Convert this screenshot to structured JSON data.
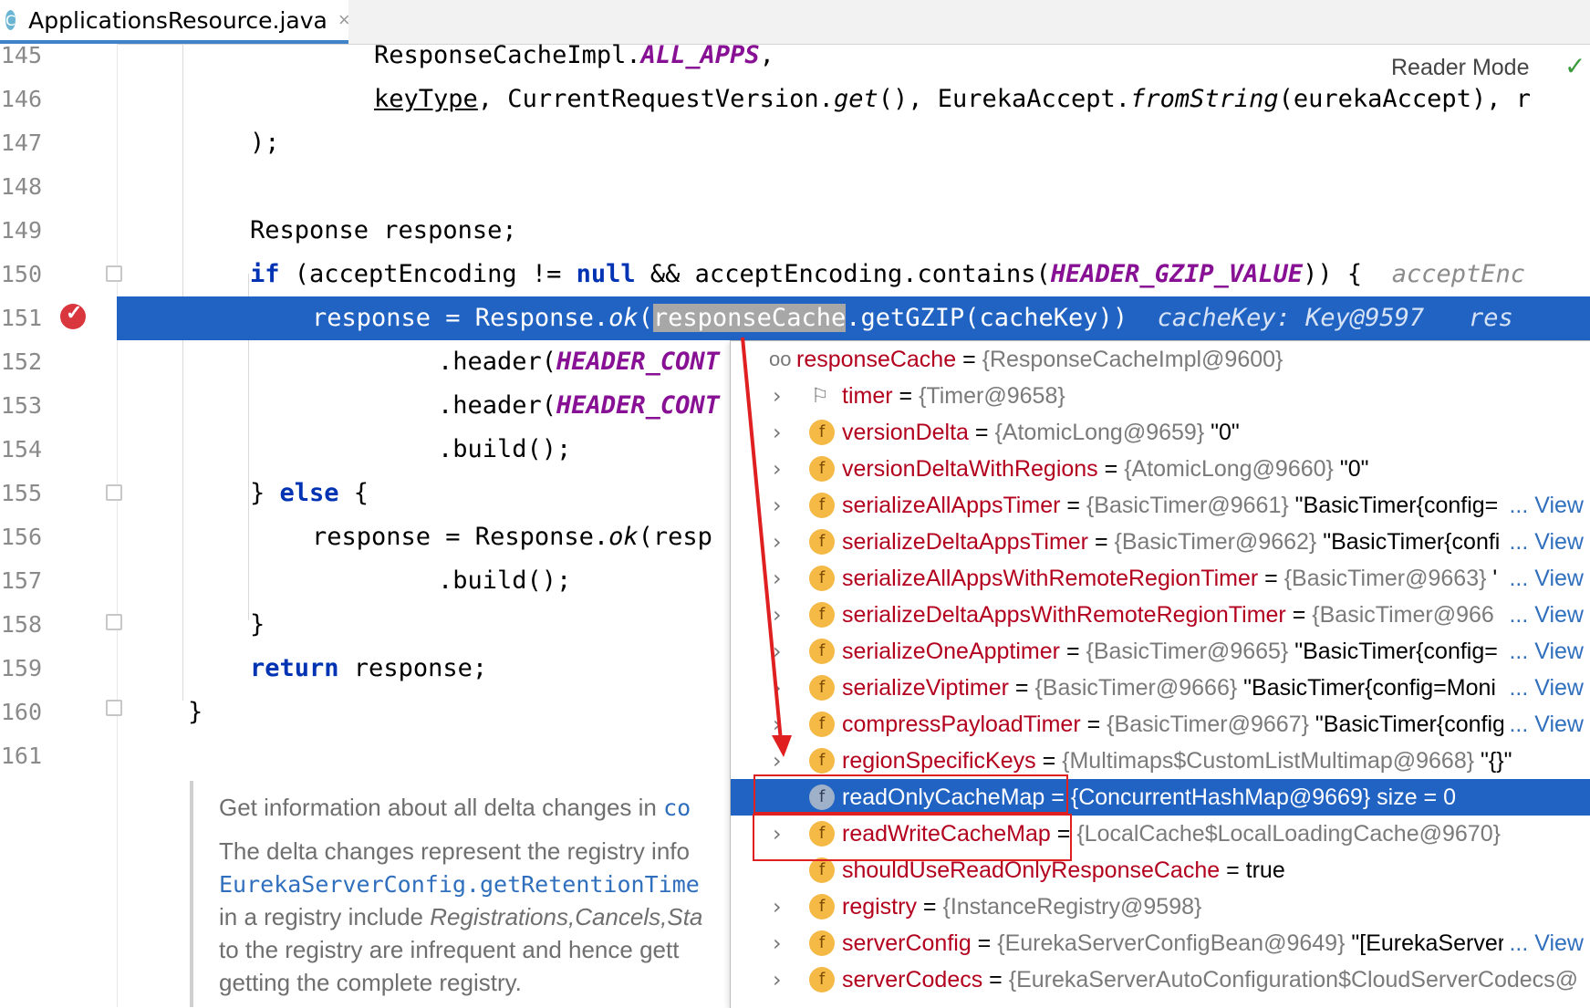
{
  "tab": {
    "icon_letter": "C",
    "filename": "ApplicationsResource.java",
    "close": "×"
  },
  "reader_mode": "Reader Mode",
  "code_lines": [
    {
      "num": "145"
    },
    {
      "num": "146"
    },
    {
      "num": "147"
    },
    {
      "num": "148"
    },
    {
      "num": "149"
    },
    {
      "num": "150"
    },
    {
      "num": "151"
    },
    {
      "num": "152"
    },
    {
      "num": "153"
    },
    {
      "num": "154"
    },
    {
      "num": "155"
    },
    {
      "num": "156"
    },
    {
      "num": "157"
    },
    {
      "num": "158"
    },
    {
      "num": "159"
    },
    {
      "num": "160"
    },
    {
      "num": "161"
    }
  ],
  "code": {
    "l145_a": "ResponseCacheImpl.",
    "l145_b": "ALL_APPS",
    "l145_c": ",",
    "l146_a": "keyType",
    "l146_b": ", CurrentRequestVersion.",
    "l146_c": "get",
    "l146_d": "(), EurekaAccept.",
    "l146_e": "fromString",
    "l146_f": "(eurekaAccept), ",
    "l146_g": "r",
    "l147": ");",
    "l149": "Response response;",
    "l150_a": "if",
    "l150_b": " (acceptEncoding != ",
    "l150_c": "null",
    "l150_d": " && acceptEncoding.contains(",
    "l150_e": "HEADER_GZIP_VALUE",
    "l150_f": ")) {",
    "l150_hint": "acceptEnc",
    "l151_a": "response = Response.",
    "l151_b": "ok",
    "l151_c": "(",
    "l151_sel": "responseCache",
    "l151_d": ".getGZIP(cacheKey))",
    "l151_hint1": "cacheKey: Key@9597",
    "l151_hint2": "res",
    "l152_a": ".header(",
    "l152_b": "HEADER_CONT",
    "l153_a": ".header(",
    "l153_b": "HEADER_CONT",
    "l154": ".build();",
    "l155_a": "} ",
    "l155_b": "else",
    "l155_c": " {",
    "l156_a": "response = Response.",
    "l156_b": "ok",
    "l156_c": "(resp",
    "l157": ".build();",
    "l158": "}",
    "l159_a": "return",
    "l159_b": " response;",
    "l160": "}"
  },
  "doc": {
    "line1_a": "Get information about all delta changes in ",
    "line1_b": "co",
    "line2": "The delta changes represent the registry info",
    "line3": "EurekaServerConfig.getRetentionTime",
    "line4_a": "in a registry include ",
    "line4_b": "Registrations,Cancels,Sta",
    "line5": "to the registry are infrequent and hence gett",
    "line6": "getting the complete registry."
  },
  "debug_popup": {
    "root": {
      "name": "responseCache",
      "eq": " = ",
      "value": "{ResponseCacheImpl@9600}"
    },
    "rows": [
      {
        "name": "timer",
        "value": "{Timer@9658}",
        "extra": "",
        "view": ""
      },
      {
        "name": "versionDelta",
        "value": "{AtomicLong@9659}",
        "extra": " \"0\"",
        "view": ""
      },
      {
        "name": "versionDeltaWithRegions",
        "value": "{AtomicLong@9660}",
        "extra": " \"0\"",
        "view": ""
      },
      {
        "name": "serializeAllAppsTimer",
        "value": "{BasicTimer@9661}",
        "extra": " \"BasicTimer{config=",
        "view": "... View"
      },
      {
        "name": "serializeDeltaAppsTimer",
        "value": "{BasicTimer@9662}",
        "extra": " \"BasicTimer{confi",
        "view": "... View"
      },
      {
        "name": "serializeAllAppsWithRemoteRegionTimer",
        "value": "{BasicTimer@9663}",
        "extra": " '",
        "view": "... View"
      },
      {
        "name": "serializeDeltaAppsWithRemoteRegionTimer",
        "value": "{BasicTimer@966",
        "extra": "",
        "view": "... View"
      },
      {
        "name": "serializeOneApptimer",
        "value": "{BasicTimer@9665}",
        "extra": " \"BasicTimer{config=",
        "view": "... View"
      },
      {
        "name": "serializeViptimer",
        "value": "{BasicTimer@9666}",
        "extra": " \"BasicTimer{config=Moni",
        "view": "... View"
      },
      {
        "name": "compressPayloadTimer",
        "value": "{BasicTimer@9667}",
        "extra": " \"BasicTimer{config",
        "view": "... View"
      },
      {
        "name": "regionSpecificKeys",
        "value": "{Multimaps$CustomListMultimap@9668}",
        "extra": " \"{}\"",
        "view": ""
      },
      {
        "name": "readOnlyCacheMap",
        "value": "{ConcurrentHashMap@9669}",
        "extra": "  size = 0",
        "view": ""
      },
      {
        "name": "readWriteCacheMap",
        "value": "{LocalCache$LocalLoadingCache@9670}",
        "extra": "",
        "view": ""
      },
      {
        "name": "shouldUseReadOnlyResponseCache",
        "value": "",
        "extra": "true",
        "view": ""
      },
      {
        "name": "registry",
        "value": "{InstanceRegistry@9598}",
        "extra": "",
        "view": ""
      },
      {
        "name": "serverConfig",
        "value": "{EurekaServerConfigBean@9649}",
        "extra": " \"[EurekaServer",
        "view": "... View"
      },
      {
        "name": "serverCodecs",
        "value": "{EurekaServerAutoConfiguration$CloudServerCodecs@",
        "extra": "",
        "view": ""
      }
    ],
    "field_icon": "f",
    "eq": " = "
  },
  "colors": {
    "selection": "#2163c3",
    "annotation": "#e02020",
    "keyword": "#0033b3",
    "constant": "#871094",
    "field_name": "#b3001e"
  }
}
